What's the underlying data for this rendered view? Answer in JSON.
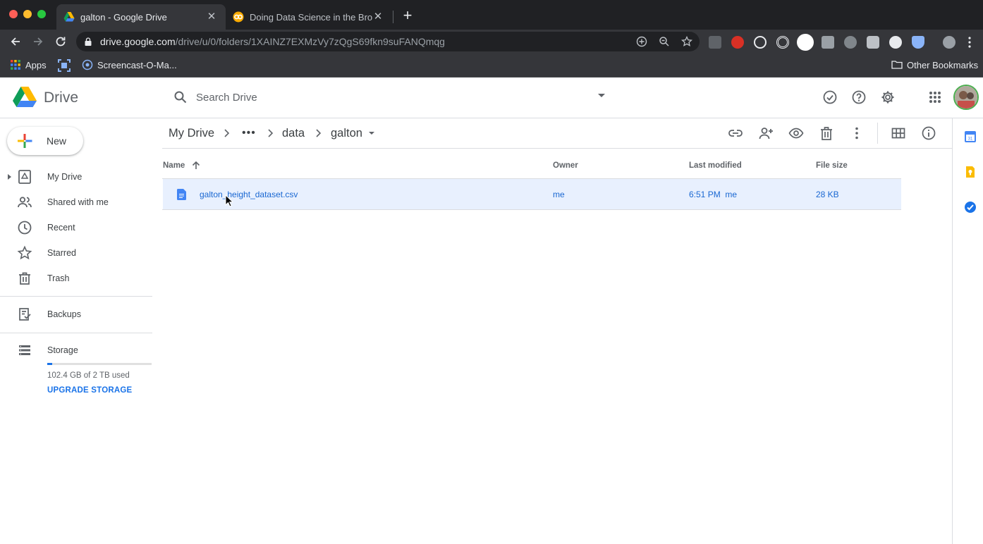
{
  "browser": {
    "tabs": [
      {
        "title": "galton - Google Drive",
        "active": true
      },
      {
        "title": "Doing Data Science in the Brov",
        "active": false
      }
    ],
    "url_host": "drive.google.com",
    "url_path": "/drive/u/0/folders/1XAINZ7EXMzVy7zQgS69fkn9suFANQmqg",
    "bookmarks": {
      "apps": "Apps",
      "screencast": "Screencast-O-Ma...",
      "other": "Other Bookmarks"
    }
  },
  "drive": {
    "logo_text": "Drive",
    "search_placeholder": "Search Drive"
  },
  "sidebar": {
    "new_label": "New",
    "items": [
      {
        "label": "My Drive",
        "icon": "my-drive-icon"
      },
      {
        "label": "Shared with me",
        "icon": "people-icon"
      },
      {
        "label": "Recent",
        "icon": "clock-icon"
      },
      {
        "label": "Starred",
        "icon": "star-icon"
      },
      {
        "label": "Trash",
        "icon": "trash-icon"
      },
      {
        "label": "Backups",
        "icon": "backups-icon"
      },
      {
        "label": "Storage",
        "icon": "storage-icon"
      }
    ],
    "storage_used_text": "102.4 GB of 2 TB used",
    "storage_used_fraction": 0.05,
    "upgrade_label": "UPGRADE STORAGE"
  },
  "breadcrumb": {
    "root": "My Drive",
    "more": "•••",
    "items": [
      "data",
      "galton"
    ]
  },
  "file_list": {
    "columns": [
      "Name",
      "Owner",
      "Last modified",
      "File size"
    ],
    "sort": "ascending",
    "rows": [
      {
        "name": "galton_height_dataset.csv",
        "owner": "me",
        "modified": "6:51 PM  me",
        "size": "28 KB",
        "selected": true
      }
    ]
  },
  "colors": {
    "accent": "#1a73e8",
    "selected_row": "#e8f0fe",
    "chrome_dark": "#202124",
    "chrome_toolbar": "#35363a"
  }
}
